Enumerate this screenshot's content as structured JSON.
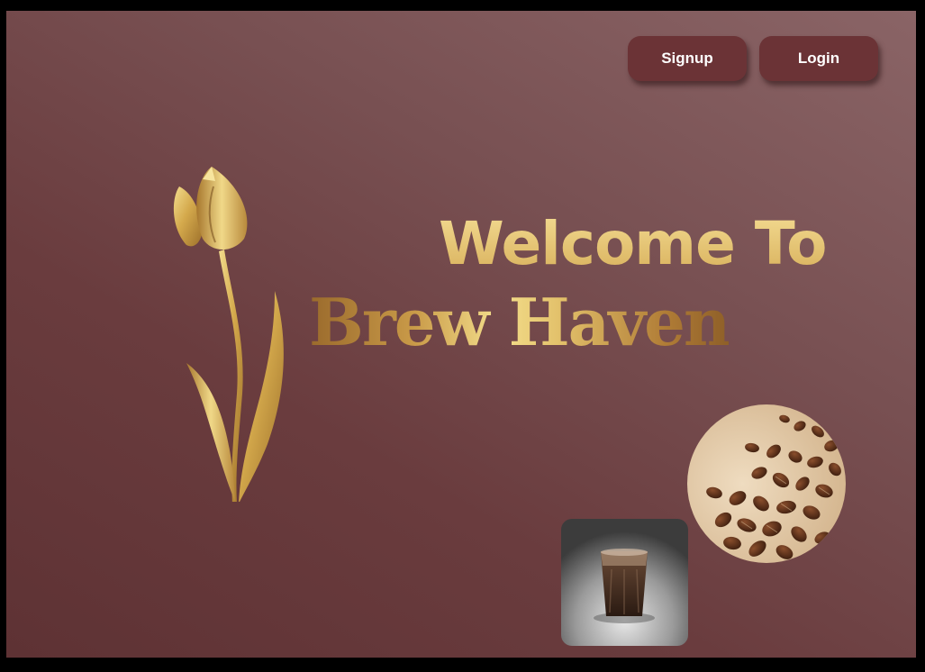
{
  "header": {
    "signup_label": "Signup",
    "login_label": "Login"
  },
  "hero": {
    "welcome_text": "Welcome To",
    "brand_name": "Brew Haven"
  },
  "icons": {
    "logo": "tulip-logo-icon",
    "beans_image": "coffee-beans-image",
    "glass_image": "coffee-glass-image"
  },
  "colors": {
    "background_dark": "#5e3234",
    "background_light": "#8a6466",
    "button": "#6b3336",
    "gold": "#e6c77a"
  }
}
